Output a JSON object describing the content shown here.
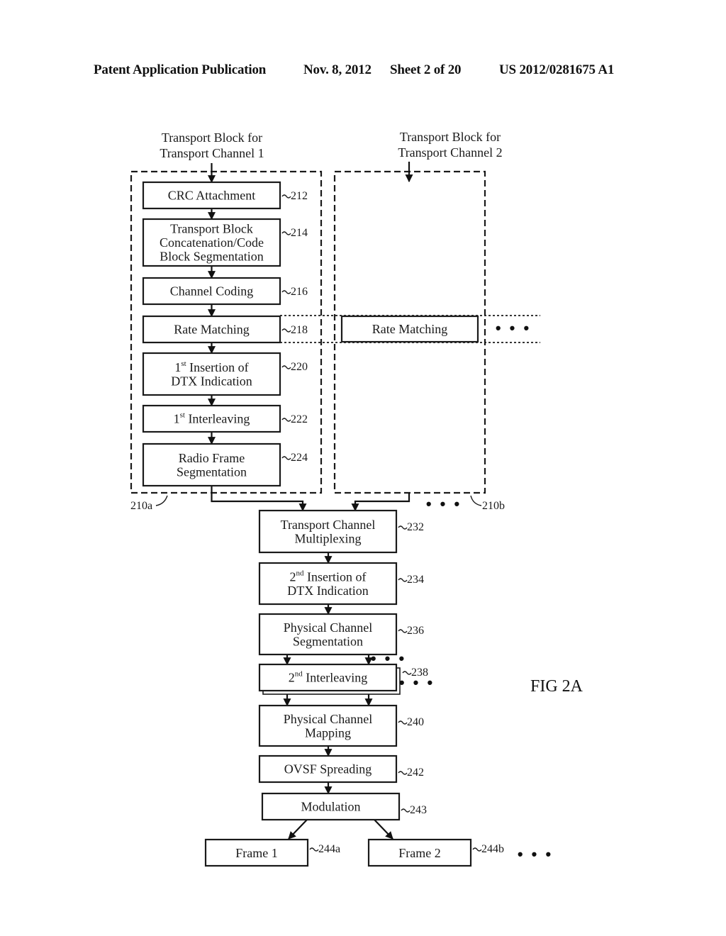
{
  "header": {
    "publication": "Patent Application Publication",
    "date": "Nov. 8, 2012",
    "sheet": "Sheet 2 of 20",
    "number": "US 2012/0281675 A1"
  },
  "figure_label": "FIG 2A",
  "inputs": {
    "channel1": [
      "Transport Block for",
      "Transport Channel 1"
    ],
    "channel2": [
      "Transport Block for",
      "Transport Channel 2"
    ]
  },
  "groups": {
    "g1_ref": "210a",
    "g2_ref": "210b"
  },
  "channel1_blocks": [
    {
      "id": "crc",
      "lines": [
        "CRC Attachment"
      ],
      "ref": "212"
    },
    {
      "id": "concat",
      "lines": [
        "Transport Block",
        "Concatenation/Code",
        "Block Segmentation"
      ],
      "ref": "214"
    },
    {
      "id": "coding",
      "lines": [
        "Channel Coding"
      ],
      "ref": "216"
    },
    {
      "id": "rate",
      "lines": [
        "Rate Matching"
      ],
      "ref": "218"
    },
    {
      "id": "dtx1",
      "sup_num": "1",
      "sup": "st",
      "lines": [
        " Insertion of",
        "DTX Indication"
      ],
      "ref": "220"
    },
    {
      "id": "intl1",
      "sup_num": "1",
      "sup": "st",
      "lines": [
        " Interleaving"
      ],
      "ref": "222"
    },
    {
      "id": "rfseg",
      "lines": [
        "Radio Frame",
        "Segmentation"
      ],
      "ref": "224"
    }
  ],
  "channel2_blocks": [
    {
      "id": "rate2",
      "lines": [
        "Rate Matching"
      ]
    }
  ],
  "common_blocks": [
    {
      "id": "mux",
      "lines": [
        "Transport Channel",
        "Multiplexing"
      ],
      "ref": "232"
    },
    {
      "id": "dtx2",
      "sup_num": "2",
      "sup": "nd",
      "lines": [
        " Insertion of",
        "DTX Indication"
      ],
      "ref": "234"
    },
    {
      "id": "pcseg",
      "lines": [
        "Physical Channel",
        "Segmentation"
      ],
      "ref": "236"
    },
    {
      "id": "intl2",
      "sup_num": "2",
      "sup": "nd",
      "lines": [
        " Interleaving"
      ],
      "ref": "238"
    },
    {
      "id": "pcmap",
      "lines": [
        "Physical Channel",
        "Mapping"
      ],
      "ref": "240"
    },
    {
      "id": "ovsf",
      "lines": [
        "OVSF Spreading"
      ],
      "ref": "242"
    },
    {
      "id": "mod",
      "lines": [
        "Modulation"
      ],
      "ref": "243"
    }
  ],
  "frames": [
    {
      "id": "frame1",
      "label": "Frame 1",
      "ref": "244a"
    },
    {
      "id": "frame2",
      "label": "Frame 2",
      "ref": "244b"
    }
  ],
  "ellipsis": "• • •"
}
